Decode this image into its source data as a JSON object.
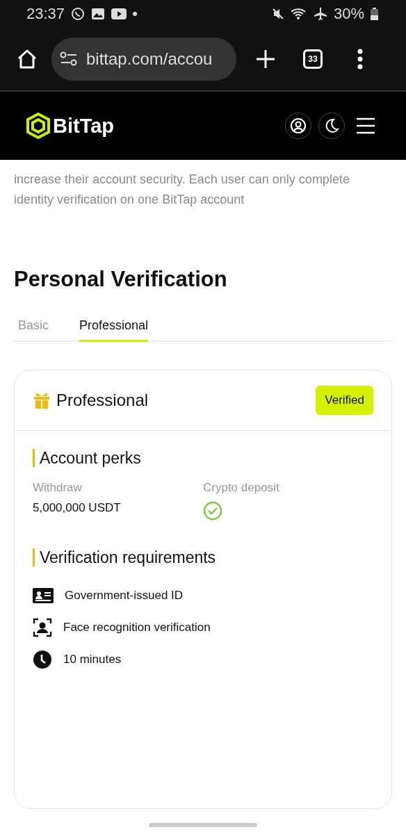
{
  "status_bar": {
    "time": "23:37",
    "battery": "30%"
  },
  "browser": {
    "url": "bittap.com/accou",
    "tab_count": "33"
  },
  "site_header": {
    "logo": "BitTap"
  },
  "intro": "increase their account security. Each user can only complete identity verification on one BitTap account",
  "heading": "Personal Verification",
  "tabs": [
    {
      "label": "Basic",
      "selected": false
    },
    {
      "label": "Professional",
      "selected": true
    }
  ],
  "card": {
    "title": "Professional",
    "status": "Verified",
    "perks_title": "Account perks",
    "perks": [
      {
        "label": "Withdraw",
        "kind": "text",
        "value": "5,000,000 USDT"
      },
      {
        "label": "Crypto deposit",
        "kind": "check"
      }
    ],
    "requirements_title": "Verification requirements",
    "requirements": [
      {
        "kind": "id",
        "text": "Government-issued ID"
      },
      {
        "kind": "face",
        "text": "Face recognition verification"
      },
      {
        "kind": "clock",
        "text": "10 minutes"
      }
    ]
  }
}
